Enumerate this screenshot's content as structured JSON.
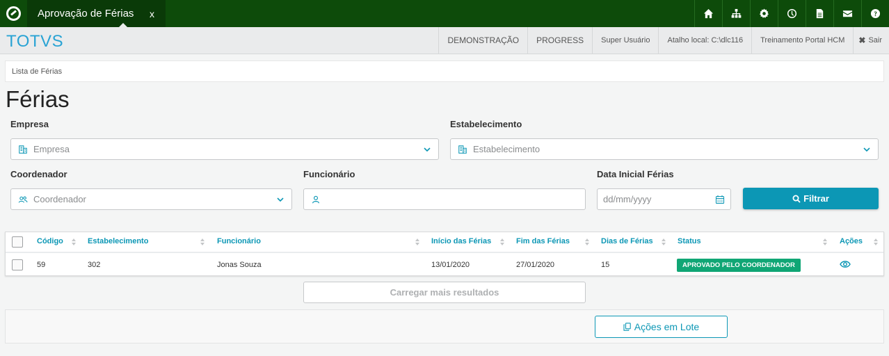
{
  "topbar": {
    "tab_title": "Aprovação de Férias",
    "tab_close": "x",
    "icons": [
      "home-icon",
      "sitemap-icon",
      "gear-icon",
      "clock-icon",
      "document-icon",
      "envelope-icon",
      "help-icon"
    ]
  },
  "subbar": {
    "brand": "TOTVS",
    "items": [
      "DEMONSTRAÇÃO",
      "PROGRESS",
      "Super Usuário",
      "Atalho local: C:\\dlc116",
      "Treinamento Portal HCM"
    ],
    "logout": "Sair"
  },
  "breadcrumb": "Lista de Férias",
  "page_title": "Férias",
  "filters": {
    "empresa": {
      "label": "Empresa",
      "placeholder": "Empresa"
    },
    "estabelecimento": {
      "label": "Estabelecimento",
      "placeholder": "Estabelecimento"
    },
    "coordenador": {
      "label": "Coordenador",
      "placeholder": "Coordenador"
    },
    "funcionario": {
      "label": "Funcionário",
      "value": ""
    },
    "data_inicial": {
      "label": "Data Inicial Férias",
      "placeholder": "dd/mm/yyyy"
    },
    "filter_button": "Filtrar"
  },
  "table": {
    "columns": [
      "Código",
      "Estabelecimento",
      "Funcionário",
      "Início das Férias",
      "Fim das Férias",
      "Dias de Férias",
      "Status",
      "Ações"
    ],
    "rows": [
      {
        "codigo": "59",
        "estabelecimento": "302",
        "funcionario": "Jonas Souza",
        "inicio": "13/01/2020",
        "fim": "27/01/2020",
        "dias": "15",
        "status": "APROVADO PELO COORDENADOR"
      }
    ]
  },
  "load_more": "Carregar mais resultados",
  "batch_actions": "Ações em Lote",
  "colors": {
    "topbar": "#0d4b0a",
    "brand": "#29a3d4",
    "primary": "#0c97b5",
    "status_approved": "#10a675"
  }
}
